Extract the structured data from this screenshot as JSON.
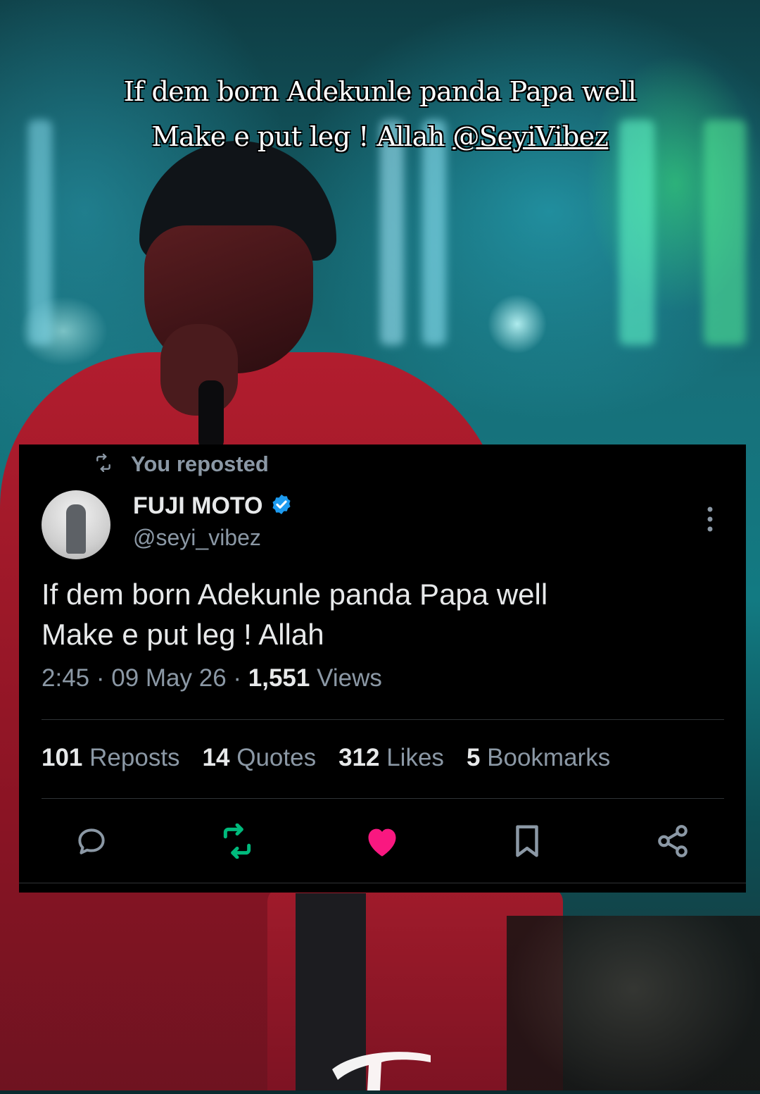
{
  "overlay": {
    "headline_line1": "If dem born Adekunle panda Papa well",
    "headline_line2_prefix": "Make e put leg ! Allah ",
    "headline_mention": "@SeyiVibez"
  },
  "post": {
    "repost_label": "You reposted",
    "author_name": "FUJI MOTO",
    "verified": true,
    "handle": "@seyi_vibez",
    "text_line1": "If dem born Adekunle panda Papa well",
    "text_line2": "Make e put leg ! Allah",
    "time": "2:45",
    "date": "09 May 26",
    "views_count": "1,551",
    "views_label": "Views",
    "separator": " · "
  },
  "stats": [
    {
      "count": "101",
      "label": "Reposts"
    },
    {
      "count": "14",
      "label": "Quotes"
    },
    {
      "count": "312",
      "label": "Likes"
    },
    {
      "count": "5",
      "label": "Bookmarks"
    }
  ],
  "colors": {
    "background": "#000000",
    "text_primary": "#e7e9ea",
    "text_secondary": "#8b98a5",
    "verified_blue": "#1d9bf0",
    "repost_green": "#00ba7c",
    "like_pink": "#f91880"
  },
  "icons": {
    "repost_header": "repost-icon",
    "reply": "reply-icon",
    "repost": "repost-icon",
    "like": "heart-icon",
    "bookmark": "bookmark-icon",
    "share": "share-icon",
    "more": "more-vertical-icon",
    "verified": "verified-badge-icon"
  }
}
